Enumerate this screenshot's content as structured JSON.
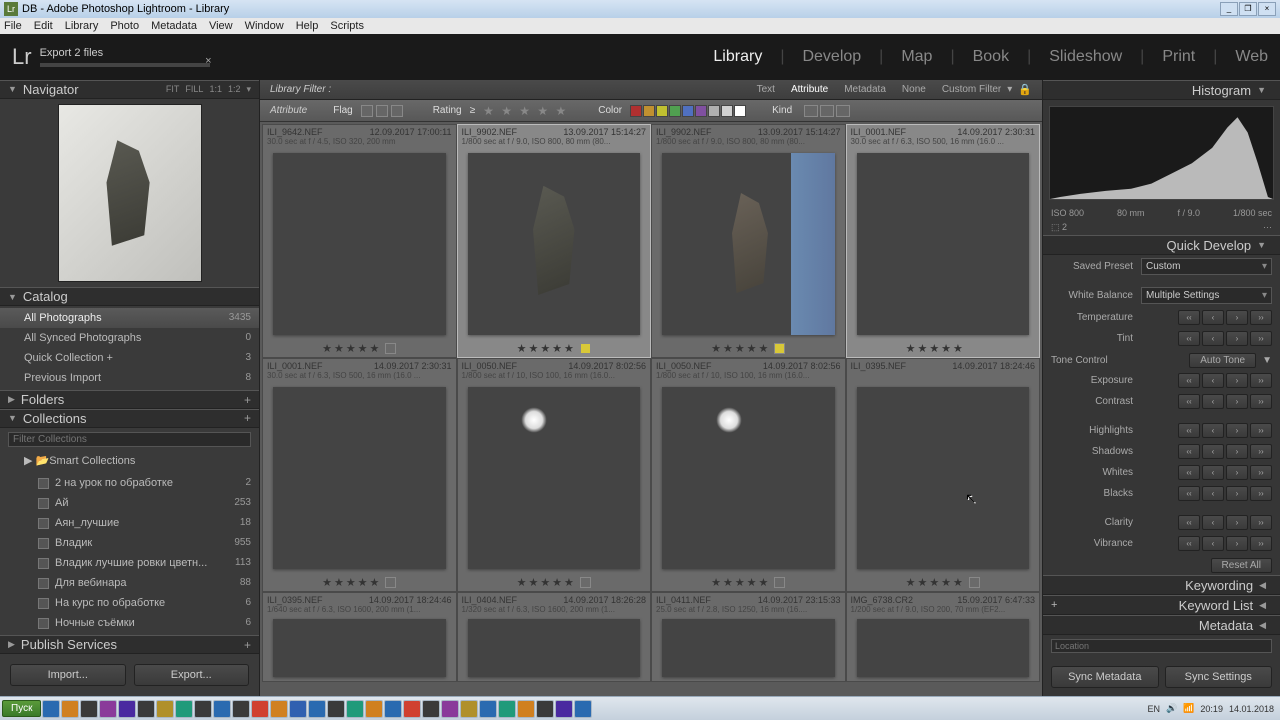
{
  "window": {
    "title": "DB - Adobe Photoshop Lightroom - Library"
  },
  "menu": [
    "File",
    "Edit",
    "Library",
    "Photo",
    "Metadata",
    "View",
    "Window",
    "Help",
    "Scripts"
  ],
  "export_progress": "Export 2 files",
  "modules": [
    "Library",
    "Develop",
    "Map",
    "Book",
    "Slideshow",
    "Print",
    "Web"
  ],
  "active_module": "Library",
  "left": {
    "navigator": {
      "title": "Navigator",
      "modes": [
        "FIT",
        "FILL",
        "1:1",
        "1:2"
      ]
    },
    "catalog": {
      "title": "Catalog",
      "items": [
        {
          "label": "All Photographs",
          "count": "3435",
          "sel": true
        },
        {
          "label": "All Synced Photographs",
          "count": "0"
        },
        {
          "label": "Quick Collection  +",
          "count": "3"
        },
        {
          "label": "Previous Import",
          "count": "8"
        }
      ]
    },
    "folders": {
      "title": "Folders"
    },
    "collections": {
      "title": "Collections",
      "filter_ph": "Filter Collections",
      "smart": "Smart Collections",
      "items": [
        {
          "label": "2 на урок по обработке",
          "count": "2"
        },
        {
          "label": "Ай",
          "count": "253"
        },
        {
          "label": "Аян_лучшие",
          "count": "18"
        },
        {
          "label": "Владик",
          "count": "955"
        },
        {
          "label": "Владик лучшие ровки цветн...",
          "count": "113"
        },
        {
          "label": "Для вебинара",
          "count": "88"
        },
        {
          "label": "На курс по обработке",
          "count": "6"
        },
        {
          "label": "Ночные съёмки",
          "count": "6"
        }
      ]
    },
    "publish": {
      "title": "Publish Services"
    },
    "import": "Import...",
    "export": "Export..."
  },
  "filter": {
    "label": "Library Filter :",
    "tabs": [
      "Text",
      "Attribute",
      "Metadata",
      "None"
    ],
    "active": "Attribute",
    "custom": "Custom Filter",
    "attr": {
      "label": "Attribute",
      "flag": "Flag",
      "rating": "Rating",
      "op": "≥",
      "color": "Color",
      "kind": "Kind"
    },
    "colors": [
      "#b03030",
      "#c09030",
      "#c0c030",
      "#50a050",
      "#5070c0",
      "#8050a0",
      "#b0b0b0",
      "#d0d0d0",
      "#fff"
    ]
  },
  "thumbs": [
    {
      "f": "ILI_9642.NEF",
      "d": "12.09.2017 17:00:11",
      "s": "30.0 sec at f / 4.5, ISO 320, 200 mm",
      "cls": "th1",
      "stars": 5,
      "lbl": ""
    },
    {
      "f": "ILI_9902.NEF",
      "d": "13.09.2017 15:14:27",
      "s": "1/800 sec at f / 9.0, ISO 800, 80 mm (80...",
      "cls": "th2",
      "stars": 5,
      "lbl": "y",
      "sel": true
    },
    {
      "f": "ILI_9902.NEF",
      "d": "13.09.2017 15:14:27",
      "s": "1/800 sec at f / 9.0, ISO 800, 80 mm (80...",
      "cls": "th2b",
      "stars": 5,
      "lbl": "y"
    },
    {
      "f": "ILI_0001.NEF",
      "d": "14.09.2017 2:30:31",
      "s": "30.0 sec at f / 6.3, ISO 500, 16 mm (16.0 ...",
      "cls": "th3",
      "stars": 5,
      "lbl": "",
      "sel": true
    },
    {
      "f": "ILI_0001.NEF",
      "d": "14.09.2017 2:30:31",
      "s": "30.0 sec at f / 6.3, ISO 500, 16 mm (16.0 ...",
      "cls": "th4",
      "stars": 5,
      "lbl": ""
    },
    {
      "f": "ILI_0050.NEF",
      "d": "14.09.2017 8:02:56",
      "s": "1/800 sec at f / 10, ISO 100, 16 mm (16.0...",
      "cls": "th5",
      "stars": 5,
      "lbl": ""
    },
    {
      "f": "ILI_0050.NEF",
      "d": "14.09.2017 8:02:56",
      "s": "1/800 sec at f / 10, ISO 100, 16 mm (16.0...",
      "cls": "th5",
      "stars": 5,
      "lbl": ""
    },
    {
      "f": "ILI_0395.NEF",
      "d": "14.09.2017 18:24:46",
      "s": "",
      "cls": "th6",
      "stars": 5,
      "lbl": ""
    }
  ],
  "row3": [
    {
      "f": "ILI_0395.NEF",
      "d": "14.09.2017 18:24:46",
      "s": "1/640 sec at f / 6.3, ISO 1600, 200 mm (1..."
    },
    {
      "f": "ILI_0404.NEF",
      "d": "14.09.2017 18:26:28",
      "s": "1/320 sec at f / 6.3, ISO 1600, 200 mm (1..."
    },
    {
      "f": "ILI_0411.NEF",
      "d": "14.09.2017 23:15:33",
      "s": "25.0 sec at f / 2.8, ISO 1250, 16 mm (16...."
    },
    {
      "f": "IMG_6738.CR2",
      "d": "15.09.2017 6:47:33",
      "s": "1/200 sec at f / 9.0, ISO 200, 70 mm (EF2..."
    }
  ],
  "right": {
    "histogram": {
      "title": "Histogram",
      "iso": "ISO 800",
      "lens": "80 mm",
      "ap": "f / 9.0",
      "sh": "1/800 sec",
      "badge": "2"
    },
    "quickdev": {
      "title": "Quick Develop",
      "preset": {
        "label": "Saved Preset",
        "val": "Custom"
      },
      "wb": {
        "label": "White Balance",
        "val": "Multiple Settings"
      },
      "temp": "Temperature",
      "tint": "Tint",
      "tone": "Tone Control",
      "autotone": "Auto Tone",
      "sliders": [
        "Exposure",
        "Contrast",
        "Highlights",
        "Shadows",
        "Whites",
        "Blacks",
        "Clarity",
        "Vibrance"
      ],
      "reset": "Reset All"
    },
    "keywording": "Keywording",
    "keywordlist": "Keyword List",
    "metadata": "Metadata",
    "location": "Location",
    "syncmeta": "Sync Metadata",
    "syncset": "Sync Settings"
  },
  "taskbar": {
    "start": "Пуск",
    "lang": "EN",
    "time": "20:19",
    "date": "14.01.2018"
  }
}
